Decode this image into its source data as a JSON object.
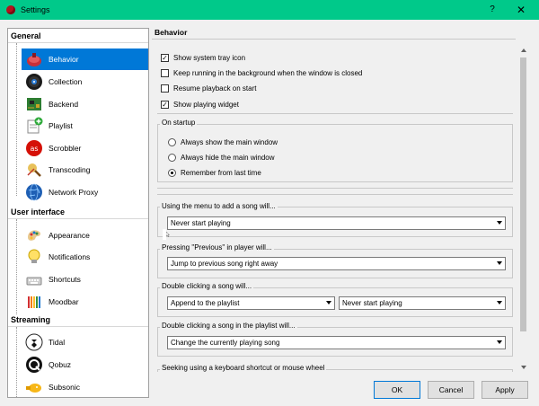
{
  "window": {
    "title": "Settings",
    "help_label": "?",
    "close_label": "✕"
  },
  "sidebar": {
    "groups": [
      {
        "label": "General",
        "items": [
          {
            "label": "Behavior",
            "icon": "behavior-icon",
            "selected": true
          },
          {
            "label": "Collection",
            "icon": "vinyl-record-icon"
          },
          {
            "label": "Backend",
            "icon": "circuit-board-icon"
          },
          {
            "label": "Playlist",
            "icon": "playlist-add-icon"
          },
          {
            "label": "Scrobbler",
            "icon": "lastfm-icon"
          },
          {
            "label": "Transcoding",
            "icon": "transcoding-icon"
          },
          {
            "label": "Network Proxy",
            "icon": "globe-icon"
          }
        ]
      },
      {
        "label": "User interface",
        "items": [
          {
            "label": "Appearance",
            "icon": "palette-icon"
          },
          {
            "label": "Notifications",
            "icon": "lightbulb-icon"
          },
          {
            "label": "Shortcuts",
            "icon": "keyboard-icon"
          },
          {
            "label": "Moodbar",
            "icon": "pencils-icon"
          }
        ]
      },
      {
        "label": "Streaming",
        "items": [
          {
            "label": "Tidal",
            "icon": "tidal-icon"
          },
          {
            "label": "Qobuz",
            "icon": "qobuz-icon"
          },
          {
            "label": "Subsonic",
            "icon": "subsonic-icon"
          }
        ]
      }
    ]
  },
  "behavior": {
    "title": "Behavior",
    "checkboxes": [
      {
        "label": "Show system tray icon",
        "checked": true
      },
      {
        "label": "Keep running in the background when the window is closed",
        "checked": false
      },
      {
        "label": "Resume playback on start",
        "checked": false
      },
      {
        "label": "Show playing widget",
        "checked": true
      }
    ],
    "startup": {
      "label": "On startup",
      "options": [
        {
          "label": "Always show the main window",
          "selected": false
        },
        {
          "label": "Always hide the main window",
          "selected": false
        },
        {
          "label": "Remember from last time",
          "selected": true
        }
      ]
    },
    "menu_add": {
      "label": "Using the menu to add a song will...",
      "value": "Never start playing"
    },
    "previous": {
      "label": "Pressing \"Previous\" in player will...",
      "value": "Jump to previous song right away"
    },
    "double_click": {
      "label": "Double clicking a song will...",
      "value_action": "Append to the playlist",
      "value_play": "Never start playing"
    },
    "double_click_playlist": {
      "label": "Double clicking a song in the playlist will...",
      "value": "Change the currently playing song"
    },
    "seeking": {
      "label": "Seeking using a keyboard shortcut or mouse wheel"
    }
  },
  "buttons": {
    "ok": "OK",
    "cancel": "Cancel",
    "apply": "Apply"
  },
  "colors": {
    "titlebar": "#00c98a",
    "selection": "#0078d7"
  }
}
